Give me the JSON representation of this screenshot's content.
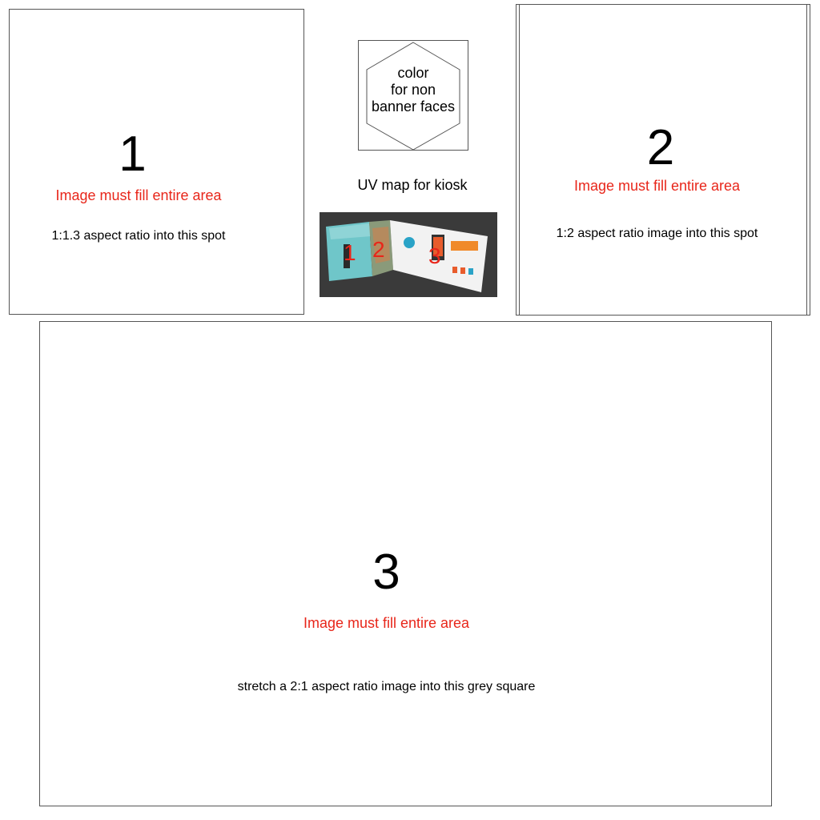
{
  "panel1": {
    "number": "1",
    "warning": "Image must fill entire area",
    "note": "1:1.3 aspect ratio into this spot"
  },
  "panel2": {
    "number": "2",
    "warning": "Image must fill entire area",
    "note": "1:2 aspect ratio image into this spot"
  },
  "panel3": {
    "number": "3",
    "warning": "Image must fill entire area",
    "note": "stretch a 2:1 aspect ratio image into this grey square"
  },
  "color_swatch": {
    "lines": [
      "color",
      "for non",
      "banner faces"
    ]
  },
  "uv_label": "UV map for kiosk",
  "kiosk_preview": {
    "labels": [
      "1",
      "2",
      "3"
    ],
    "label_color": "#e8261a"
  },
  "colors": {
    "warning": "#e8261a",
    "border": "#555555",
    "preview_bg": "#3a3a3a"
  }
}
